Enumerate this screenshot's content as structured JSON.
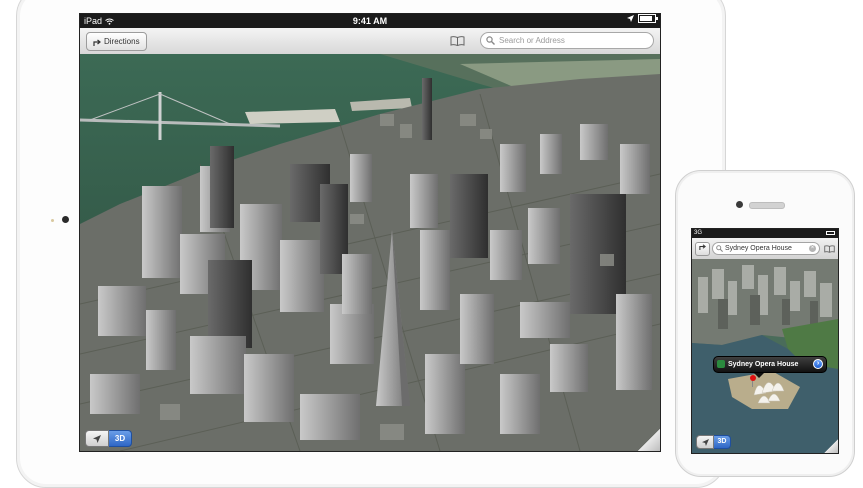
{
  "ipad": {
    "status": {
      "carrier": "iPad",
      "time": "9:41 AM"
    },
    "toolbar": {
      "directions_label": "Directions",
      "search_placeholder": "Search or Address"
    },
    "controls": {
      "three_d_label": "3D"
    }
  },
  "iphone": {
    "status": {
      "carrier": "3G"
    },
    "toolbar": {
      "search_value": "Sydney Opera House"
    },
    "callout": {
      "title": "Sydney Opera House"
    },
    "controls": {
      "three_d_label": "3D"
    }
  },
  "icons": {
    "wifi": "wifi-icon",
    "location_arrow": "location-arrow-icon",
    "battery": "battery-icon",
    "directions_arrow": "directions-arrow-icon",
    "bookmarks": "bookmarks-icon",
    "search": "search-icon",
    "clear": "clear-icon",
    "info": "info-icon"
  },
  "colors": {
    "three_d_active": "#2f67c6",
    "pin": "#dd1111",
    "water": "#3a5a49"
  }
}
